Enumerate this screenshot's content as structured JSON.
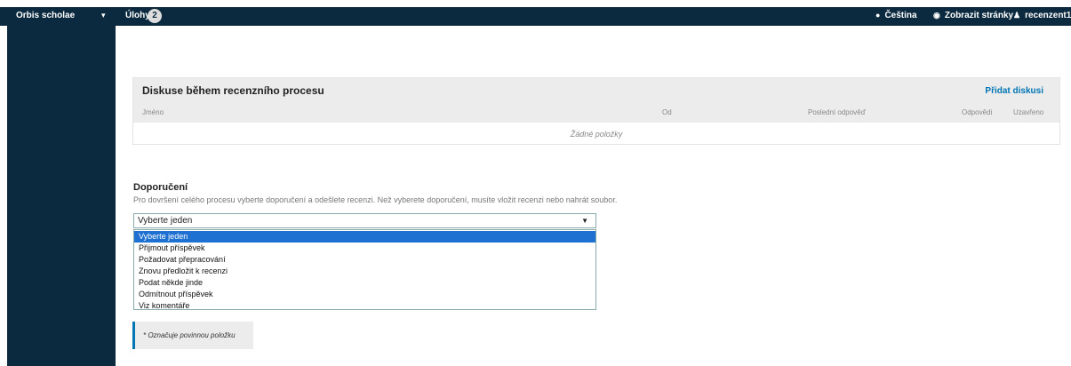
{
  "topbar": {
    "brand": "Orbis scholae",
    "brand_caret": "▾",
    "tasks_label": "Úlohy",
    "tasks_count": "2",
    "language": "Čeština",
    "view_site": "Zobrazit stránky",
    "user": "recenzent1",
    "icons": {
      "language": "globe-icon",
      "view_site": "eye-icon",
      "user": "user-icon"
    }
  },
  "discussion": {
    "title": "Diskuse během recenzního procesu",
    "add_label": "Přidat diskusi",
    "columns": [
      "Jméno",
      "Od",
      "Poslední odpověď",
      "Odpovědi",
      "Uzavřeno"
    ],
    "empty": "Žádné položky"
  },
  "recommendation": {
    "title": "Doporučení",
    "description": "Pro dovršení celého procesu vyberte doporučení a odešlete recenzi. Než vyberete doporučení, musíte vložit recenzi nebo nahrát soubor.",
    "selected": "Vyberte jeden",
    "options": [
      "Vyberte jeden",
      "Přijmout příspěvek",
      "Požadovat přepracování",
      "Znovu předložit k recenzi",
      "Podat někde jinde",
      "Odmítnout příspěvek",
      "Viz komentáře"
    ]
  },
  "required_note": "* Označuje povinnou položku",
  "colors": {
    "navy": "#0b2a3f",
    "link": "#0075b3",
    "highlight": "#1e70d1",
    "panel": "#ececec"
  }
}
